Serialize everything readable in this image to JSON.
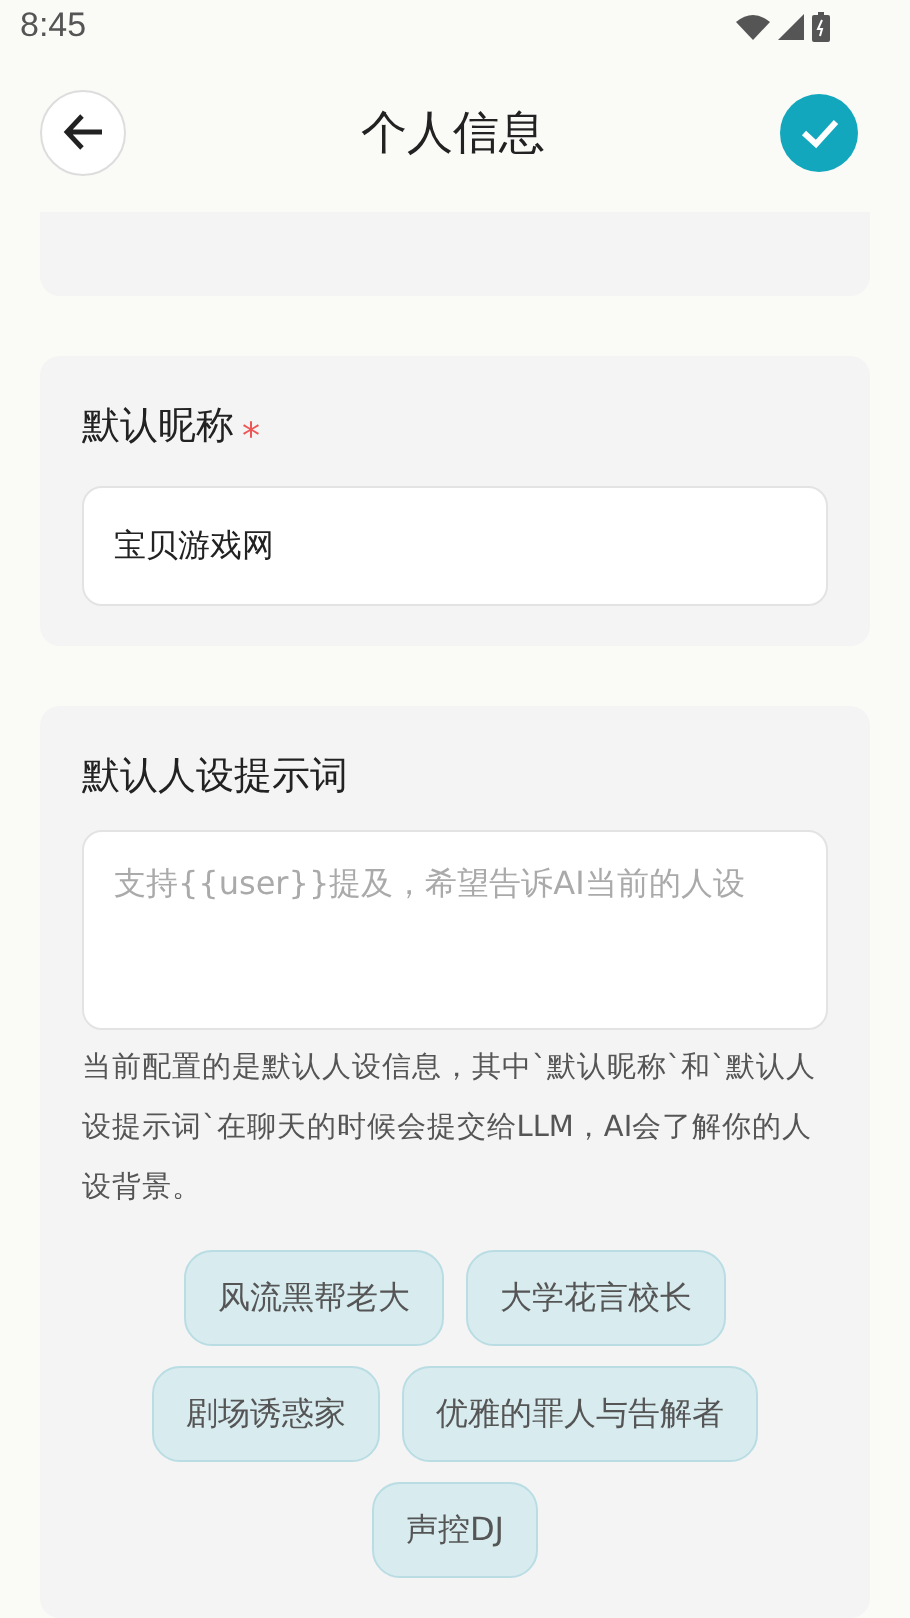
{
  "status_bar": {
    "time": "8:45"
  },
  "header": {
    "title": "个人信息"
  },
  "nickname": {
    "label": "默认昵称",
    "required_mark": "*",
    "value": "宝贝游戏网"
  },
  "persona": {
    "label": "默认人设提示词",
    "placeholder": "支持{{user}}提及，希望告诉AI当前的人设",
    "description": "当前配置的是默认人设信息，其中`默认昵称`和`默认人设提示词`在聊天的时候会提交给LLM，AI会了解你的人设背景。",
    "presets": [
      [
        "风流黑帮老大",
        "大学花言校长"
      ],
      [
        "剧场诱惑家",
        "优雅的罪人与告解者"
      ],
      [
        "声控DJ"
      ]
    ]
  }
}
